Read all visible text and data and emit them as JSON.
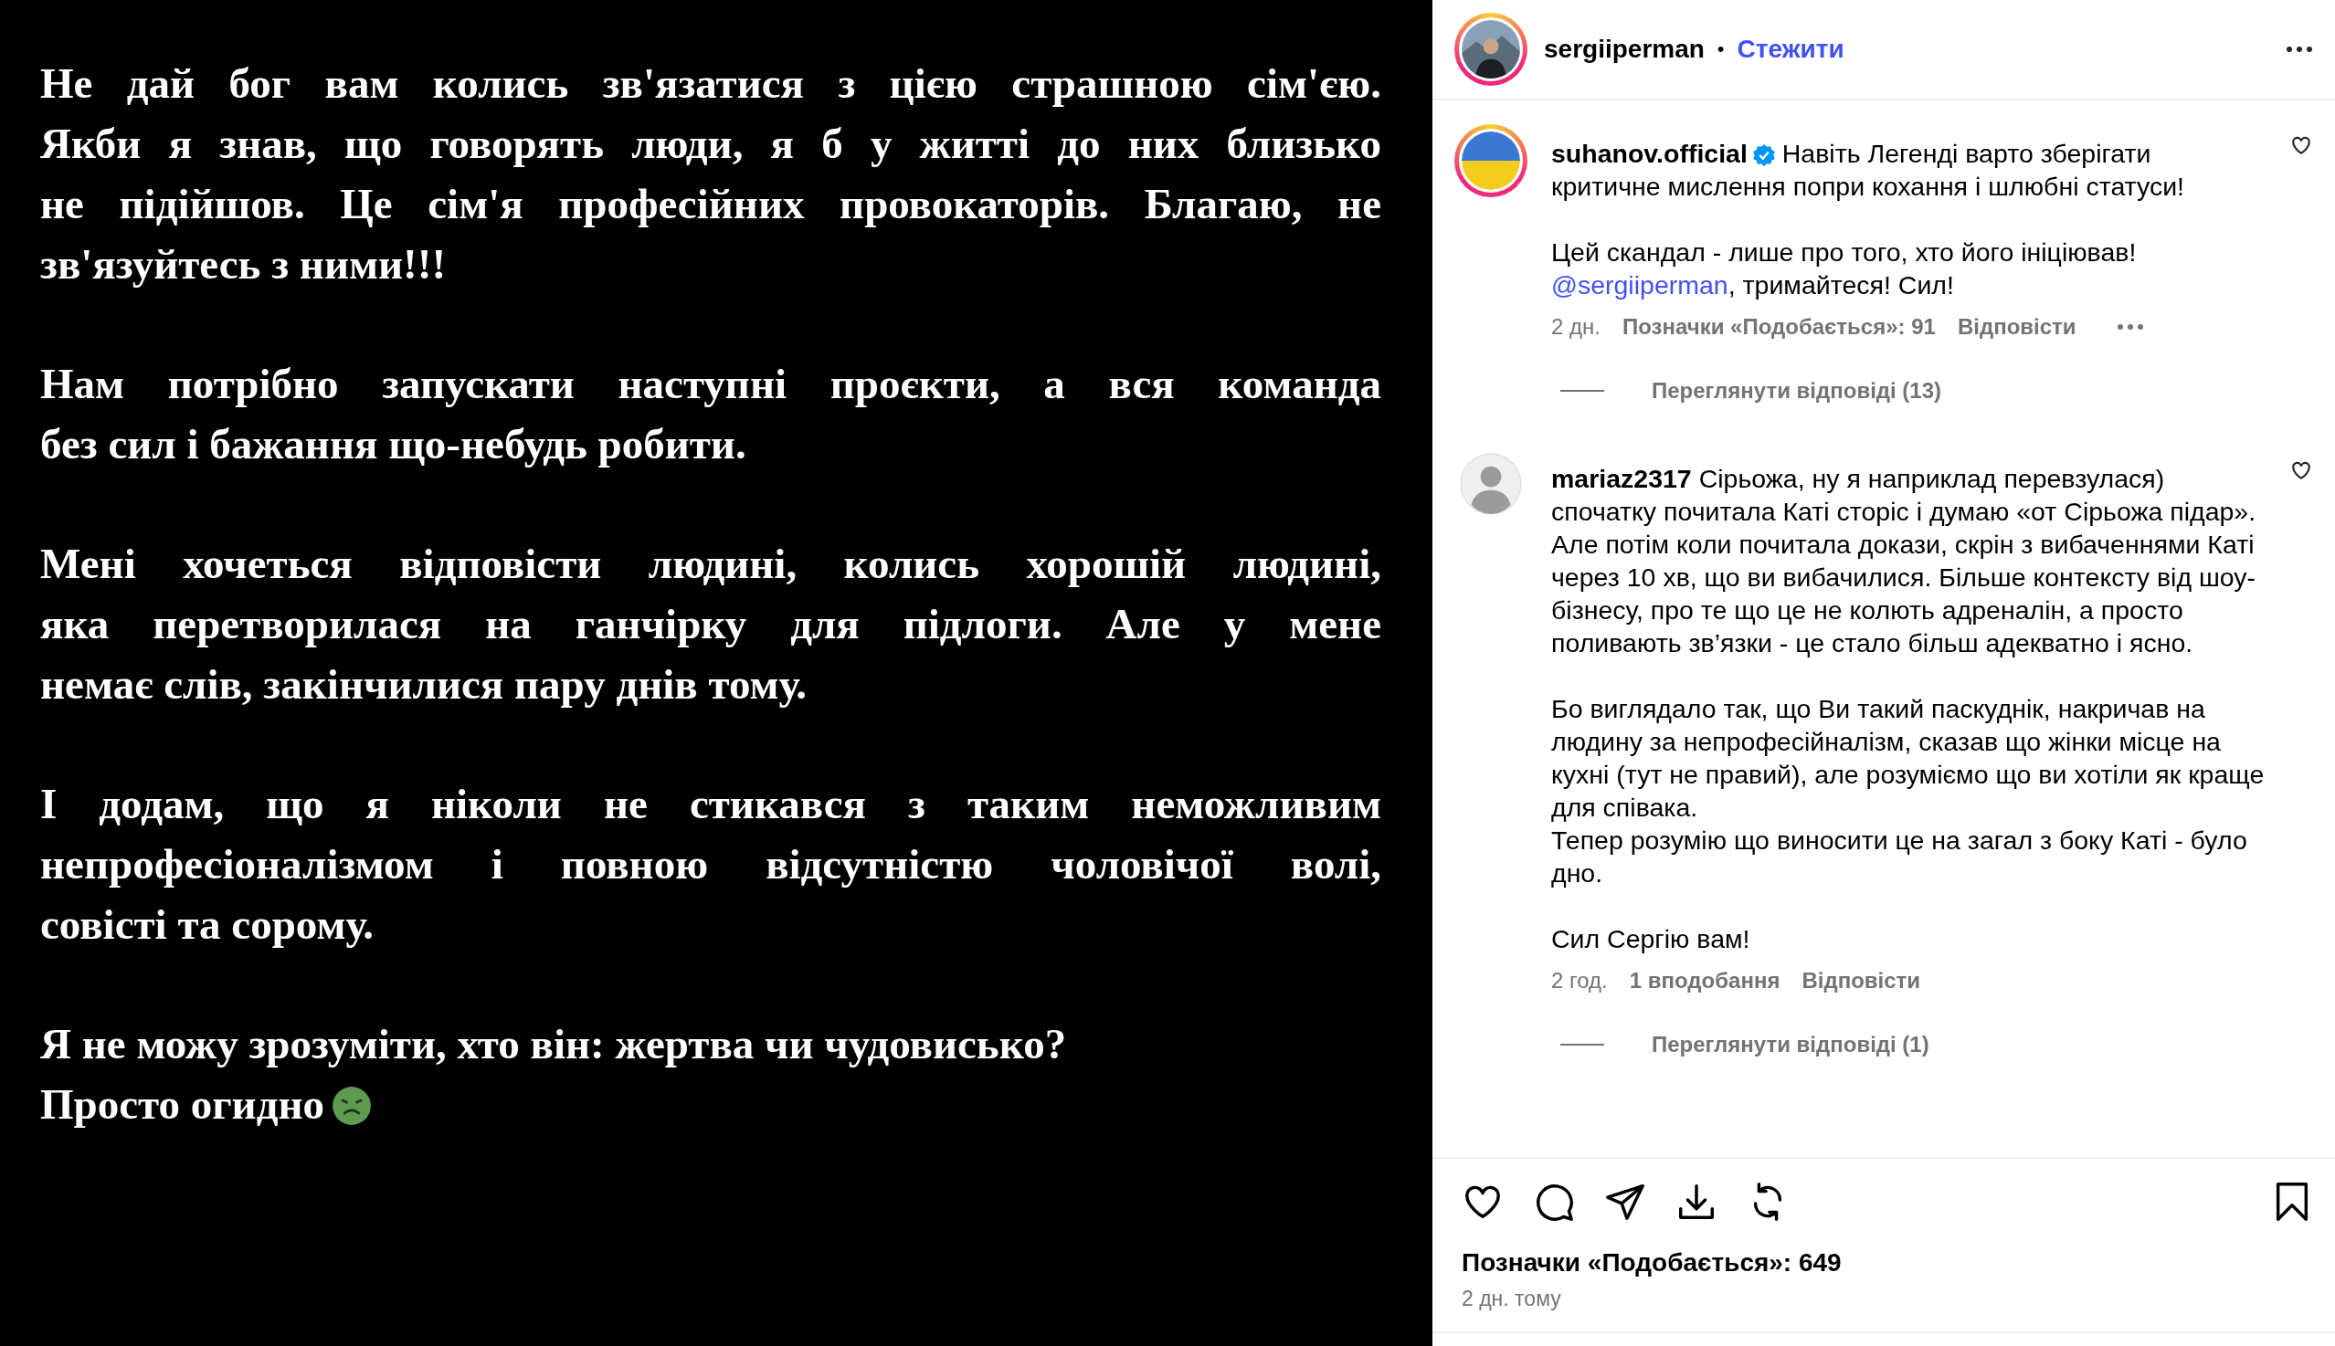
{
  "post_image": {
    "paragraphs": [
      {
        "lines": [
          "Не дай бог вам колись зв'язатися з цією страшною сім'єю.",
          "Якби я знав, що говорять люди, я б у житті до них близько",
          "не підійшов. Це сім'я професійних провокаторів. Благаю, не",
          "зв'язуйтесь з ними!!!"
        ]
      },
      {
        "lines": [
          "Нам потрібно запускати наступні проєкти, а вся команда",
          "без сил і бажання що-небудь робити."
        ]
      },
      {
        "lines": [
          "Мені хочеться відповісти людині, колись хорошій людині,",
          "яка перетворилася на ганчірку для підлоги. Але у мене",
          "немає слів, закінчилися пару днів тому."
        ]
      },
      {
        "lines": [
          "І додам, що я ніколи не стикався з таким неможливим",
          "непрофесіоналізмом і повною відсутністю чоловічої волі,",
          "совісті та сорому."
        ]
      },
      {
        "lines": [
          "Я не можу зрозуміти, хто він: жертва чи чудовисько?",
          "Просто огидно"
        ],
        "justified": false,
        "emoji": true
      }
    ]
  },
  "header": {
    "username": "sergiiperman",
    "separator": "•",
    "follow": "Стежити"
  },
  "comments": [
    {
      "username": "suhanov.official",
      "verified": true,
      "kind": "flag-avatar",
      "parts": [
        {
          "kind": "text",
          "text": "Навіть Легенді варто зберігати критичне мислення попри кохання і шлюбні статуси!\n\nЦей скандал - лише про того, хто його ініціював!\n"
        },
        {
          "kind": "mention",
          "text": "@sergiiperman"
        },
        {
          "kind": "text",
          "text": ", тримайтеся! Сил!"
        }
      ],
      "time": "2 дн.",
      "likes": "Позначки «Подобається»: 91",
      "reply": "Відповісти",
      "more": true,
      "view_replies": "Переглянути відповіді (13)"
    },
    {
      "username": "mariaz2317",
      "verified": false,
      "kind": "default-avatar",
      "parts": [
        {
          "kind": "text",
          "text": "Сірьожа, ну я наприклад перевзулася)\nспочатку почитала Каті сторіс і думаю «от Сірьожа підар».\nАле потім коли почитала докази, скрін з вибаченнями Каті через 10 хв, що ви вибачилися. Більше контексту від шоу-бізнесу, про те що це не колють адреналін, а просто поливають зв’язки - це стало більш адекватно і ясно.\n\nБо виглядало так, що Ви такий паскуднік, накричав на людину за непрофесійналізм, сказав що жінки місце на кухні (тут не правий), але розуміємо що ви хотіли як краще для співака.\nТепер розумію що виносити це на загал з боку Каті - було дно.\n\nСил Сергію вам!"
        }
      ],
      "time": "2 год.",
      "likes": "1 вподобання",
      "reply": "Відповісти",
      "more": false,
      "view_replies": "Переглянути відповіді (1)"
    }
  ],
  "footer": {
    "likes": "Позначки «Подобається»: 649",
    "date": "2 дн. тому"
  }
}
